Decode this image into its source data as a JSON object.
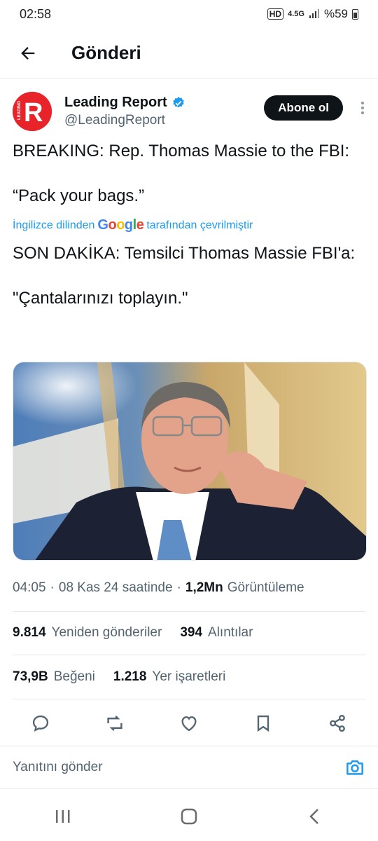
{
  "status_bar": {
    "time": "02:58",
    "network": "4.5G",
    "battery": "%59"
  },
  "header": {
    "title": "Gönderi",
    "back_icon": "arrow-left-icon"
  },
  "post": {
    "author_name": "Leading Report",
    "handle": "@LeadingReport",
    "verified": true,
    "follow_label": "Abone ol",
    "text_original": "BREAKING: Rep. Thomas Massie to the FBI:\n\n“Pack your bags.”",
    "translation_prefix": "İngilizce dilinden",
    "translation_brand": "Google",
    "translation_suffix": "tarafından çevrilmiştir",
    "text_translated": "SON DAKİKA: Temsilci Thomas Massie FBI'a:\n\n\"Çantalarınızı toplayın.\"",
    "time": "04:05",
    "date": "08 Kas 24 saatinde",
    "views_count": "1,2Mn",
    "views_label": "Görüntüleme"
  },
  "stats": {
    "reposts_count": "9.814",
    "reposts_label": "Yeniden gönderiler",
    "quotes_count": "394",
    "quotes_label": "Alıntılar",
    "likes_count": "73,9B",
    "likes_label": "Beğeni",
    "bookmarks_count": "1.218",
    "bookmarks_label": "Yer işaretleri"
  },
  "reply": {
    "placeholder": "Yanıtını gönder"
  },
  "colors": {
    "accent": "#1d9bf0",
    "brand_red": "#e8232a",
    "text": "#0f1419",
    "muted": "#536471"
  }
}
